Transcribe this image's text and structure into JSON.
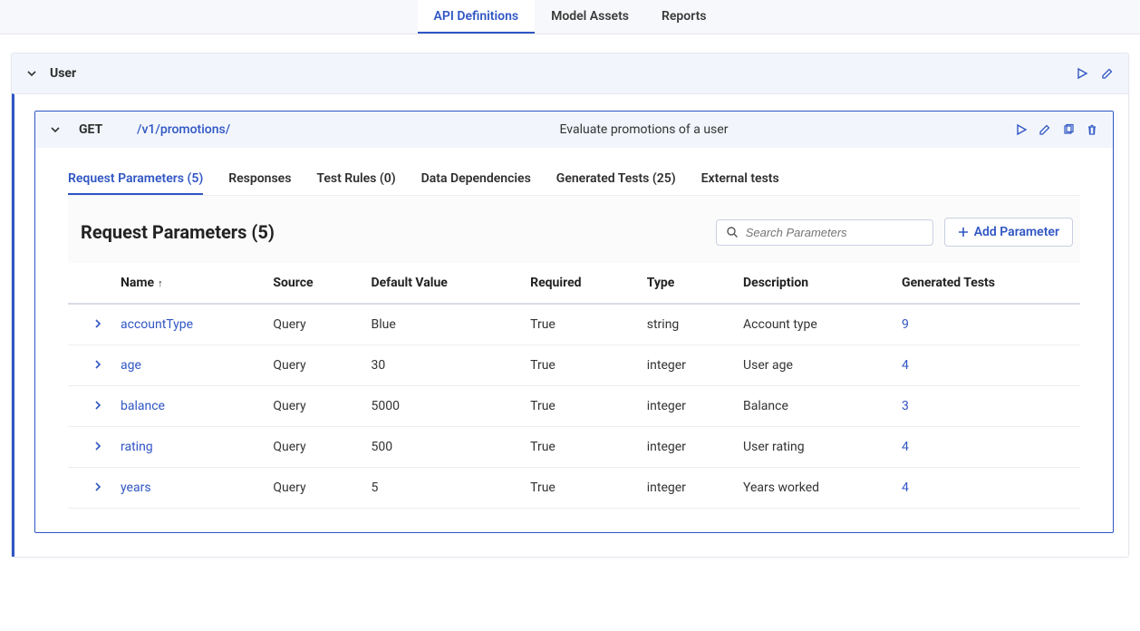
{
  "topTabs": {
    "api_defs": "API Definitions",
    "model_assets": "Model Assets",
    "reports": "Reports"
  },
  "section": {
    "title": "User"
  },
  "endpoint": {
    "method": "GET",
    "path": "/v1/promotions/",
    "description": "Evaluate promotions of a user"
  },
  "subTabs": {
    "request_params": "Request Parameters (5)",
    "responses": "Responses",
    "test_rules": "Test Rules (0)",
    "data_deps": "Data Dependencies",
    "generated_tests": "Generated Tests (25)",
    "external_tests": "External tests"
  },
  "rp": {
    "title": "Request Parameters (5)",
    "search_placeholder": "Search Parameters",
    "add_label": "Add Parameter"
  },
  "columns": {
    "name": "Name",
    "source": "Source",
    "default": "Default Value",
    "required": "Required",
    "type": "Type",
    "description": "Description",
    "generated_tests": "Generated Tests"
  },
  "rows": [
    {
      "name": "accountType",
      "source": "Query",
      "default": "Blue",
      "required": "True",
      "type": "string",
      "description": "Account type",
      "tests": "9"
    },
    {
      "name": "age",
      "source": "Query",
      "default": "30",
      "required": "True",
      "type": "integer",
      "description": "User age",
      "tests": "4"
    },
    {
      "name": "balance",
      "source": "Query",
      "default": "5000",
      "required": "True",
      "type": "integer",
      "description": "Balance",
      "tests": "3"
    },
    {
      "name": "rating",
      "source": "Query",
      "default": "500",
      "required": "True",
      "type": "integer",
      "description": "User rating",
      "tests": "4"
    },
    {
      "name": "years",
      "source": "Query",
      "default": "5",
      "required": "True",
      "type": "integer",
      "description": "Years worked",
      "tests": "4"
    }
  ]
}
